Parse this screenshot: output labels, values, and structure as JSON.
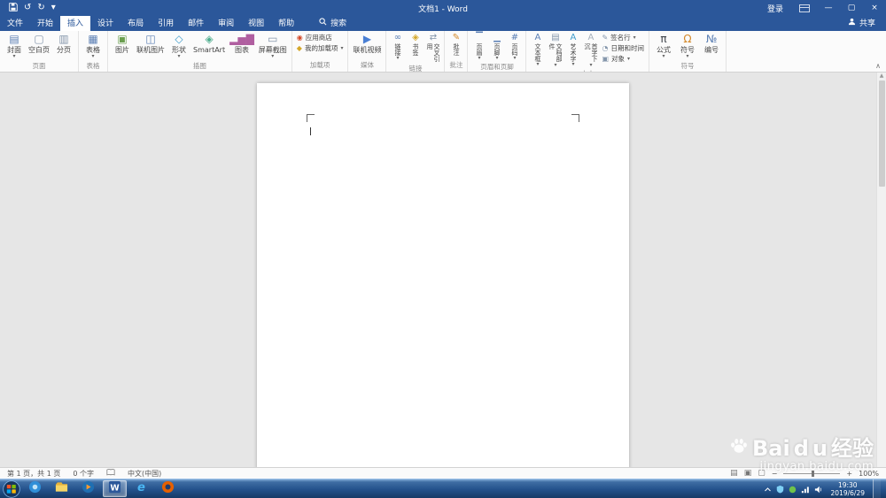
{
  "titlebar": {
    "title": "文档1 - Word",
    "signin_label": "登录",
    "controls": {
      "minimize": "—",
      "restore": "▢",
      "close": "×"
    }
  },
  "quick_access": {
    "undo": "↺",
    "redo": "↻",
    "more": "▾"
  },
  "ribbon": {
    "tabs": [
      {
        "label": "文件",
        "file": true
      },
      {
        "label": "开始"
      },
      {
        "label": "插入",
        "active": true
      },
      {
        "label": "设计"
      },
      {
        "label": "布局"
      },
      {
        "label": "引用"
      },
      {
        "label": "邮件"
      },
      {
        "label": "审阅"
      },
      {
        "label": "视图"
      },
      {
        "label": "帮助"
      }
    ],
    "search_label": "搜索",
    "share_label": "共享",
    "collapse_glyph": "∧",
    "groups": [
      {
        "label": "页面",
        "buttons": [
          {
            "label": "封面",
            "icon": "▤",
            "type": "large",
            "dd": true,
            "color": "#5b7fb4"
          },
          {
            "label": "空白页",
            "icon": "▢",
            "type": "large",
            "color": "#8496ab"
          },
          {
            "label": "分页",
            "icon": "▥",
            "type": "large",
            "color": "#8496ab"
          }
        ]
      },
      {
        "label": "表格",
        "buttons": [
          {
            "label": "表格",
            "icon": "▦",
            "type": "large",
            "dd": true,
            "color": "#5b7fb4"
          }
        ]
      },
      {
        "label": "插图",
        "buttons": [
          {
            "label": "图片",
            "icon": "▣",
            "type": "large",
            "color": "#6a9e4f"
          },
          {
            "label": "联机图片",
            "icon": "◫",
            "type": "large",
            "color": "#5b7fb4"
          },
          {
            "label": "形状",
            "icon": "◇",
            "type": "large",
            "dd": true,
            "color": "#3f9ccb"
          },
          {
            "label": "SmartArt",
            "icon": "◈",
            "type": "large",
            "color": "#4fae8f"
          },
          {
            "label": "图表",
            "icon": "▂▅▇",
            "type": "large",
            "color": "#b05fa0"
          },
          {
            "label": "屏幕截图",
            "icon": "▭",
            "type": "large",
            "dd": true,
            "color": "#8496ab"
          }
        ]
      },
      {
        "label": "加载项",
        "buttons": [
          {
            "stack": [
              {
                "label": "应用商店",
                "icon": "◉",
                "color": "#d44a2a"
              },
              {
                "label": "我的加载项",
                "icon": "◆",
                "dd": true,
                "color": "#d4a72a"
              }
            ]
          }
        ]
      },
      {
        "label": "媒体",
        "buttons": [
          {
            "label": "联机视频",
            "icon": "▶",
            "type": "large",
            "color": "#4a7fd4"
          }
        ]
      },
      {
        "label": "链接",
        "buttons": [
          {
            "label": "链接",
            "icon": "∞",
            "type": "vertical",
            "dd": true,
            "color": "#5b7fb4"
          },
          {
            "label": "书签",
            "icon": "◈",
            "type": "vertical",
            "color": "#d4a72a"
          },
          {
            "label": "交叉引用",
            "icon": "⇄",
            "type": "vertical",
            "color": "#8496ab"
          }
        ]
      },
      {
        "label": "批注",
        "buttons": [
          {
            "label": "批注",
            "icon": "✎",
            "type": "vertical",
            "color": "#d4892a"
          }
        ]
      },
      {
        "label": "页眉和页脚",
        "buttons": [
          {
            "label": "页眉",
            "icon": "▔",
            "type": "vertical",
            "dd": true,
            "color": "#5b7fb4"
          },
          {
            "label": "页脚",
            "icon": "▁",
            "type": "vertical",
            "dd": true,
            "color": "#5b7fb4"
          },
          {
            "label": "页码",
            "icon": "#",
            "type": "vertical",
            "dd": true,
            "color": "#5b7fb4"
          }
        ]
      },
      {
        "label": "文本",
        "buttons": [
          {
            "label": "文本框",
            "icon": "A",
            "type": "vertical",
            "dd": true,
            "color": "#5b7fb4"
          },
          {
            "label": "文档部件",
            "icon": "▤",
            "type": "vertical",
            "dd": true,
            "color": "#8496ab"
          },
          {
            "label": "艺术字",
            "icon": "A",
            "type": "vertical",
            "dd": true,
            "color": "#3f9ccb"
          },
          {
            "label": "首字下沉",
            "icon": "A",
            "type": "vertical",
            "dd": true,
            "color": "#a7b1bc"
          },
          {
            "stack": [
              {
                "label": "签名行",
                "icon": "✎",
                "dd": true,
                "color": "#8496ab"
              },
              {
                "label": "日期和时间",
                "icon": "◔",
                "color": "#8496ab"
              },
              {
                "label": "对象",
                "icon": "▣",
                "dd": true,
                "color": "#8496ab"
              }
            ]
          }
        ]
      },
      {
        "label": "符号",
        "buttons": [
          {
            "label": "公式",
            "icon": "π",
            "type": "large",
            "dd": true,
            "color": "#3a3f46"
          },
          {
            "label": "符号",
            "icon": "Ω",
            "type": "large",
            "dd": true,
            "color": "#d4892a"
          },
          {
            "label": "编号",
            "icon": "№",
            "type": "large",
            "color": "#5b7fb4"
          }
        ]
      }
    ]
  },
  "scrollbar": {
    "up": "▲",
    "down": "▼"
  },
  "statusbar": {
    "page_info": "第 1 页，共 1 页",
    "word_count": "0 个字",
    "language": "中文(中国)",
    "zoom_out": "−",
    "zoom_in": "+",
    "zoom_level": "100%",
    "views": [
      {
        "name": "read-mode-view",
        "glyph": "▤"
      },
      {
        "name": "print-layout-view",
        "glyph": "▣"
      },
      {
        "name": "web-layout-view",
        "glyph": "▢"
      }
    ]
  },
  "taskbar": {
    "items": [
      {
        "name": "media-center"
      },
      {
        "name": "explorer"
      },
      {
        "name": "media-player"
      },
      {
        "name": "word",
        "active": true
      },
      {
        "name": "ie"
      },
      {
        "name": "firefox"
      }
    ],
    "tray_items": [
      {
        "name": "hidden-icons"
      },
      {
        "name": "security"
      },
      {
        "name": "update"
      },
      {
        "name": "network"
      },
      {
        "name": "volume"
      }
    ],
    "clock": {
      "time": "19:30",
      "date": "2019/6/29"
    }
  },
  "watermark": {
    "brand_latin": "Bai",
    "brand_latin2": "d",
    "brand_latin3": "u",
    "brand_cn": "经验",
    "url": "jingyan.baidu.com"
  }
}
